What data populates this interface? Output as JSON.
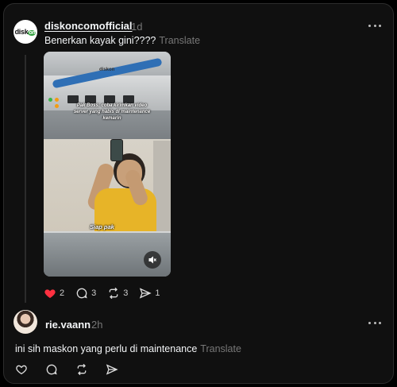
{
  "post": {
    "username": "diskoncomofficial",
    "time": "1d",
    "caption": "Benerkan kayak gini????",
    "translate": "Translate",
    "avatar_logo": "diskon",
    "video": {
      "logo": "diskon",
      "overlay_text": "Pak Boss: coba kirimkan video server yang habis di maintenance kemarin",
      "reply_text": "Siap pak",
      "muted": true
    },
    "likes": "2",
    "comments": "3",
    "reposts": "3",
    "shares": "1",
    "liked": true
  },
  "reply": {
    "username": "rie.vaann",
    "time": "2h",
    "caption": "ini sih maskon yang perlu di maintenance",
    "translate": "Translate"
  },
  "icons": {
    "heart": "heart-icon",
    "comment": "comment-icon",
    "repost": "repost-icon",
    "share": "share-icon",
    "more": "more-icon",
    "mute": "volume-muted-icon"
  },
  "colors": {
    "background": "#101010",
    "like_red": "#ff3040",
    "muted_text": "#777777"
  }
}
